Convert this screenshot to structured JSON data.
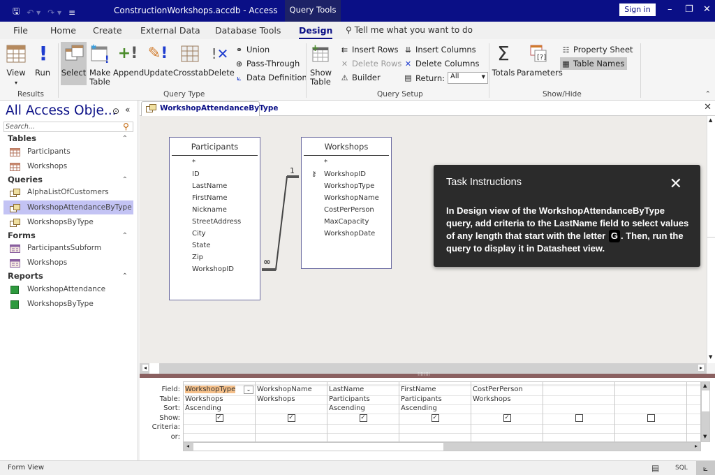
{
  "titlebar": {
    "title": "ConstructionWorkshops.accdb - Access",
    "context_tab": "Query Tools",
    "sign_in": "Sign in",
    "minimize": "–",
    "restore": "❐",
    "close": "✕"
  },
  "tabs": [
    {
      "label": "File"
    },
    {
      "label": "Home"
    },
    {
      "label": "Create"
    },
    {
      "label": "External Data"
    },
    {
      "label": "Database Tools"
    },
    {
      "label": "Design",
      "active": true
    }
  ],
  "tell_me": "Tell me what you want to do",
  "ribbon": {
    "results": {
      "label": "Results",
      "view": "View",
      "run": "Run"
    },
    "query_type": {
      "label": "Query Type",
      "select": "Select",
      "make_table": "Make Table",
      "append": "Append",
      "update": "Update",
      "crosstab": "Crosstab",
      "delete": "Delete",
      "union": "Union",
      "pass_through": "Pass-Through",
      "data_definition": "Data Definition"
    },
    "query_setup": {
      "label": "Query Setup",
      "show_table": "Show Table",
      "insert_rows": "Insert Rows",
      "delete_rows": "Delete Rows",
      "builder": "Builder",
      "insert_columns": "Insert Columns",
      "delete_columns": "Delete Columns",
      "return_label": "Return:",
      "return_value": "All"
    },
    "show_hide": {
      "label": "Show/Hide",
      "totals": "Totals",
      "parameters": "Parameters",
      "property_sheet": "Property Sheet",
      "table_names": "Table Names"
    }
  },
  "nav": {
    "title": "All Access Obje...",
    "search_placeholder": "Search...",
    "sections": [
      {
        "label": "Tables",
        "items": [
          "Participants",
          "Workshops"
        ]
      },
      {
        "label": "Queries",
        "items": [
          "AlphaListOfCustomers",
          "WorkshopAttendanceByType",
          "WorkshopsByType"
        ]
      },
      {
        "label": "Forms",
        "items": [
          "ParticipantsSubform",
          "Workshops"
        ]
      },
      {
        "label": "Reports",
        "items": [
          "WorkshopAttendance",
          "WorkshopsByType"
        ]
      }
    ],
    "selected": "WorkshopAttendanceByType"
  },
  "document_tab": "WorkshopAttendanceByType",
  "tables": [
    {
      "name": "Participants",
      "fields": [
        "*",
        "ID",
        "LastName",
        "FirstName",
        "Nickname",
        "StreetAddress",
        "City",
        "State",
        "Zip",
        "WorkshopID"
      ]
    },
    {
      "name": "Workshops",
      "fields": [
        "*",
        "WorkshopID",
        "WorkshopType",
        "WorkshopName",
        "CostPerPerson",
        "MaxCapacity",
        "WorkshopDate"
      ],
      "primary_key": "WorkshopID"
    }
  ],
  "relationship": {
    "one_side": "1",
    "many_side": "∞"
  },
  "grid": {
    "row_labels": [
      "Field:",
      "Table:",
      "Sort:",
      "Show:",
      "Criteria:",
      "or:"
    ],
    "columns": [
      {
        "field": "WorkshopType",
        "table": "Workshops",
        "sort": "Ascending",
        "show": true,
        "criteria": "",
        "or": ""
      },
      {
        "field": "WorkshopName",
        "table": "Workshops",
        "sort": "",
        "show": true,
        "criteria": "",
        "or": ""
      },
      {
        "field": "LastName",
        "table": "Participants",
        "sort": "Ascending",
        "show": true,
        "criteria": "",
        "or": ""
      },
      {
        "field": "FirstName",
        "table": "Participants",
        "sort": "Ascending",
        "show": true,
        "criteria": "",
        "or": ""
      },
      {
        "field": "CostPerPerson",
        "table": "Workshops",
        "sort": "",
        "show": true,
        "criteria": "",
        "or": ""
      },
      {
        "field": "",
        "table": "",
        "sort": "",
        "show": false,
        "criteria": "",
        "or": ""
      },
      {
        "field": "",
        "table": "",
        "sort": "",
        "show": false,
        "criteria": "",
        "or": ""
      }
    ]
  },
  "task": {
    "title": "Task Instructions",
    "text_before": "In Design view of the WorkshopAttendanceByType query, add criteria to the LastName field to select values of any length that start with the letter",
    "key": "G",
    "text_after": ". Then, run the query to display it in Datasheet view."
  },
  "status": {
    "text": "Form View",
    "sql": "SQL"
  }
}
